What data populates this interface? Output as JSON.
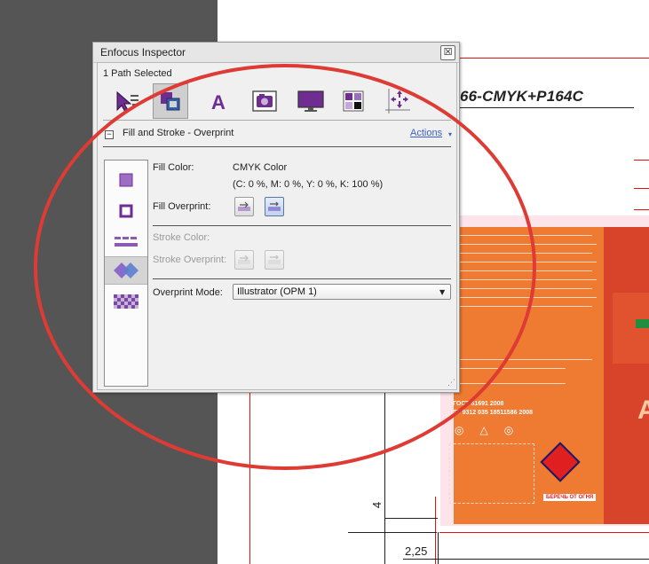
{
  "document": {
    "heading": "66-CMYK+P164C",
    "label_gost_1": "ГОСТ 51691 2008",
    "label_gost_2": "ТУ 9312 035 18511586 2008",
    "label_warning": "БЕРЕЧЬ ОТ ОГНЯ",
    "label_letter": "А",
    "dimension_vertical": "4",
    "dimension_horizontal": "2,25"
  },
  "inspector": {
    "title": "Enfocus Inspector",
    "close_glyph": "☒",
    "selection_status": "1 Path Selected",
    "section": {
      "collapse_glyph": "−",
      "title": "Fill and Stroke - Overprint",
      "actions_label": "Actions",
      "actions_chevron": "▾"
    },
    "fill": {
      "color_label": "Fill Color:",
      "color_space": "CMYK Color",
      "color_values": "(C: 0 %, M: 0 %, Y: 0 %, K: 100 %)",
      "overprint_label": "Fill Overprint:"
    },
    "stroke": {
      "color_label": "Stroke Color:",
      "overprint_label": "Stroke Overprint:"
    },
    "overprint_mode": {
      "label": "Overprint Mode:",
      "value": "Illustrator (OPM 1)",
      "arrow": "▼"
    },
    "resize_grip": "⋰"
  },
  "colors": {
    "accent_purple": "#6f2c91",
    "annotation_red": "#dd3b34",
    "link_blue": "#3b5fc4"
  },
  "icons": {
    "toolbar": [
      "select-path-icon",
      "fill-stroke-icon",
      "text-icon",
      "image-icon",
      "display-icon",
      "color-separation-icon",
      "position-icon"
    ],
    "side_list": [
      "fill-square-icon",
      "stroke-square-icon",
      "dashed-stroke-icon",
      "overprint-icon",
      "transparency-icon"
    ]
  }
}
